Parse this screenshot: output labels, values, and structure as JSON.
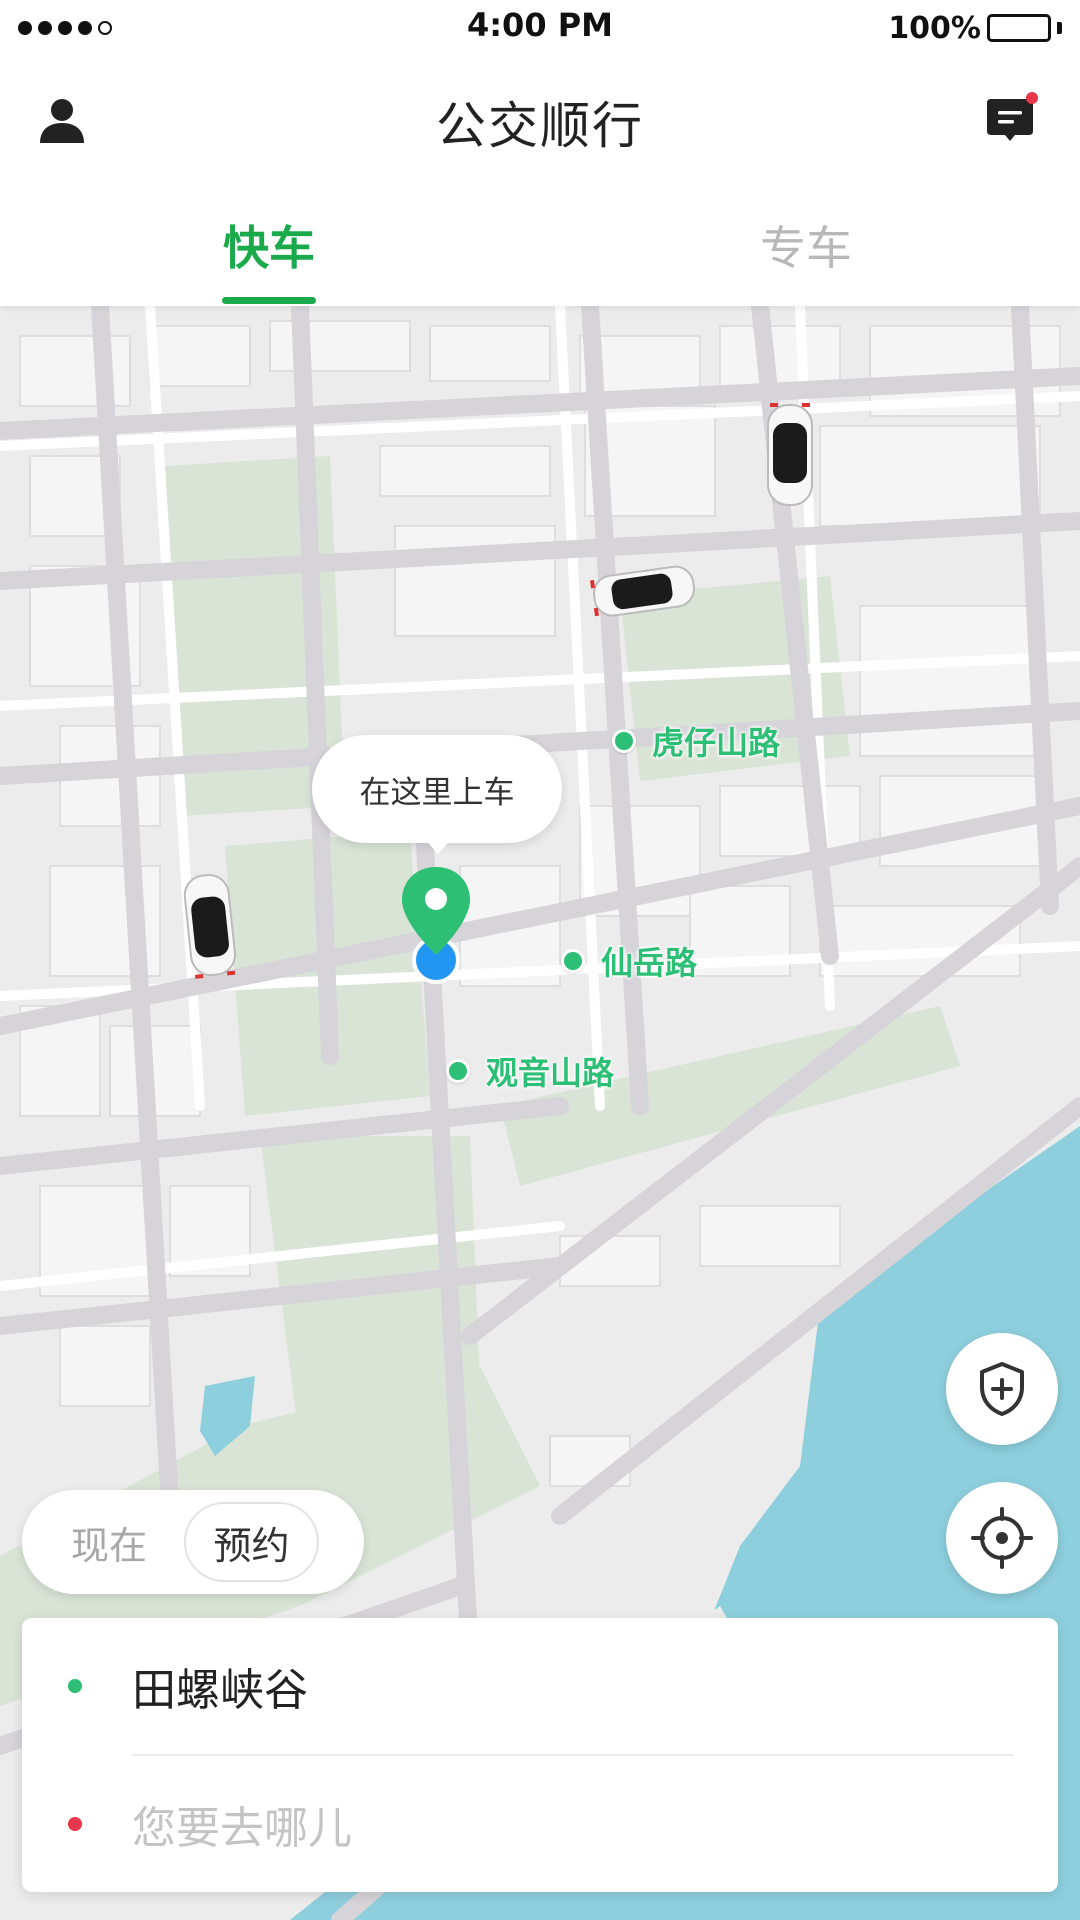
{
  "status_bar": {
    "time": "4:00 PM",
    "battery": "100%"
  },
  "header": {
    "title": "公交顺行",
    "user_icon": "person-icon",
    "message_icon": "message-icon",
    "message_badge_color": "#e8364a"
  },
  "tabs": [
    {
      "label": "快车",
      "active": true
    },
    {
      "label": "专车",
      "active": false
    }
  ],
  "map": {
    "pickup_callout": "在这里上车",
    "places": [
      {
        "label": "虎仔山路"
      },
      {
        "label": "仙岳路"
      },
      {
        "label": "观音山路"
      }
    ],
    "cars": 3
  },
  "time_toggle": {
    "now": "现在",
    "reserve": "预约"
  },
  "address": {
    "from": "田螺峡谷",
    "to_placeholder": "您要去哪儿",
    "from_color": "#2cbf75",
    "to_color": "#e8364a"
  },
  "colors": {
    "accent": "#1aaa4c",
    "place": "#2cbf75",
    "user_location": "#2196f3"
  }
}
